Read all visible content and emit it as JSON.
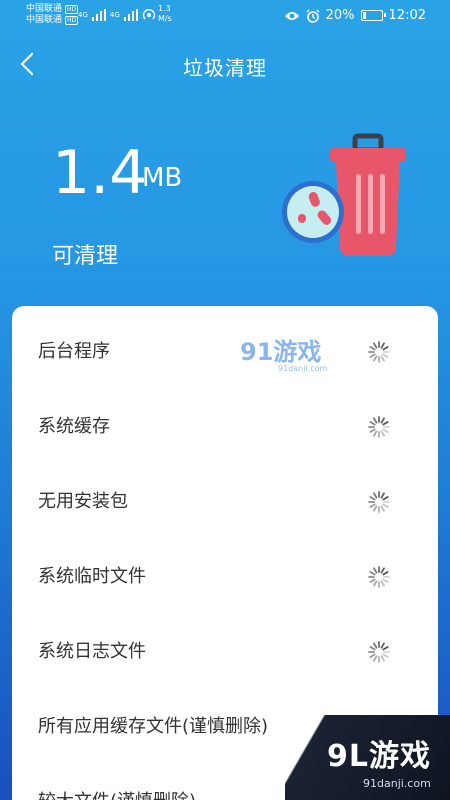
{
  "status_bar": {
    "carrier_1": "中国联通",
    "carrier_2": "中国联通",
    "hd_badge": "HD",
    "network_1": "4G",
    "network_2": "4G",
    "speed_value": "1.3",
    "speed_unit": "M/s",
    "battery_percent": "20%",
    "battery_level": 0.2,
    "time": "12:02"
  },
  "nav": {
    "title": "垃圾清理"
  },
  "summary": {
    "size_value": "1.4",
    "size_unit": "MB",
    "label": "可清理"
  },
  "items": [
    {
      "label": "后台程序"
    },
    {
      "label": "系统缓存"
    },
    {
      "label": "无用安装包"
    },
    {
      "label": "系统临时文件"
    },
    {
      "label": "系统日志文件"
    },
    {
      "label": "所有应用缓存文件(谨慎删除)"
    },
    {
      "label": "较大文件(谨慎删除)"
    }
  ],
  "watermark": {
    "mid_logo": "91游戏",
    "mid_sub": "91danji.com",
    "corner_logo": "9L游戏",
    "corner_sub": "91danji.com"
  },
  "colors": {
    "background_top": "#2aa3e6",
    "background_bottom": "#1a4fc0",
    "trash_can": "#e8566a",
    "bug_circle": "#c6eef0"
  }
}
